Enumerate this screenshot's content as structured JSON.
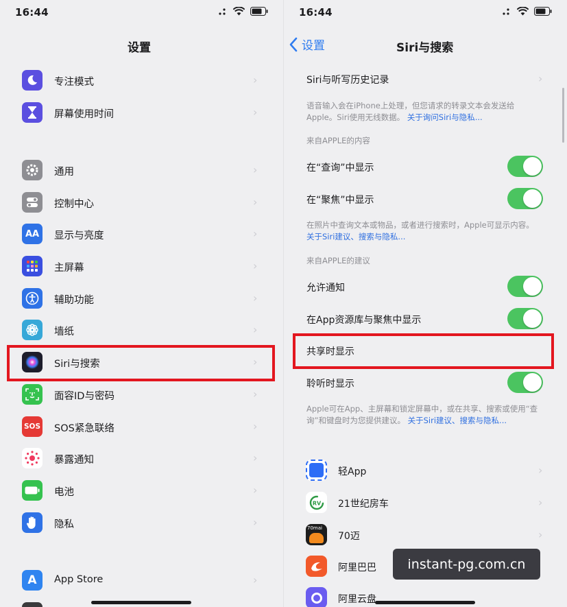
{
  "left": {
    "status": {
      "time": "16:44"
    },
    "title": "设置",
    "items": [
      {
        "label": "专注模式",
        "icon": "moon-icon",
        "color": "#5b4fe0"
      },
      {
        "label": "屏幕使用时间",
        "icon": "hourglass-icon",
        "color": "#5b4fe0"
      },
      {
        "label": "通用",
        "icon": "gear-icon",
        "color": "#8e8e93"
      },
      {
        "label": "控制中心",
        "icon": "switches-icon",
        "color": "#8e8e93"
      },
      {
        "label": "显示与亮度",
        "icon": "text-size-icon",
        "icon_text": "AA",
        "color": "#2f72e6"
      },
      {
        "label": "主屏幕",
        "icon": "grid-icon",
        "color": "#3a4fe0"
      },
      {
        "label": "辅助功能",
        "icon": "accessibility-icon",
        "color": "#2f72e6"
      },
      {
        "label": "墙纸",
        "icon": "flower-icon",
        "color": "#37a8d8"
      },
      {
        "label": "Siri与搜索",
        "icon": "siri-icon",
        "color": "#1d1d2b"
      },
      {
        "label": "面容ID与密码",
        "icon": "face-id-icon",
        "color": "#35c24f"
      },
      {
        "label": "SOS紧急联络",
        "icon": "sos-icon",
        "icon_text": "SOS",
        "color": "#e53935"
      },
      {
        "label": "暴露通知",
        "icon": "exposure-icon",
        "color": "#ffffff"
      },
      {
        "label": "电池",
        "icon": "battery-icon",
        "color": "#35c24f"
      },
      {
        "label": "隐私",
        "icon": "hand-icon",
        "color": "#2f72e6"
      },
      {
        "label": "App Store",
        "icon": "app-store-icon",
        "icon_text": "A",
        "color": "#2f84f0"
      }
    ]
  },
  "right": {
    "status": {
      "time": "16:44"
    },
    "back_label": "设置",
    "title": "Siri与搜索",
    "history_label": "Siri与听写历史记录",
    "note1": "语音输入会在iPhone上处理，但您请求的转录文本会发送给Apple。Siri使用无线数据。",
    "note1_link": "关于询问Siri与隐私...",
    "section1": "来自APPLE的内容",
    "rows1": [
      {
        "label": "在“查询”中显示",
        "on": true
      },
      {
        "label": "在“聚焦”中显示",
        "on": true
      }
    ],
    "note2": "在照片中查询文本或物品，或者进行搜索时，Apple可显示内容。",
    "note2_link": "关于Siri建议、搜索与隐私...",
    "section2": "来自APPLE的建议",
    "rows2": [
      {
        "label": "允许通知",
        "on": true
      },
      {
        "label": "在App资源库与聚焦中显示",
        "on": true
      },
      {
        "label": "共享时显示",
        "on": false
      },
      {
        "label": "聆听时显示",
        "on": true
      }
    ],
    "note3": "Apple可在App、主屏幕和锁定屏幕中，或在共享、搜索或使用“查询”和键盘时为您提供建议。",
    "note3_link": "关于Siri建议、搜索与隐私...",
    "apps": [
      {
        "label": "轻App",
        "icon": "light-app-icon",
        "color": "#2d6df6"
      },
      {
        "label": "21世纪房车",
        "icon": "rv21-icon",
        "color": "#ffffff"
      },
      {
        "label": "70迈",
        "icon": "70mai-icon",
        "icon_text": "70mai",
        "color": "#1d1d1d"
      },
      {
        "label": "阿里巴巴",
        "icon": "alibaba-icon",
        "color": "#f2592a"
      },
      {
        "label": "阿里云盘",
        "icon": "aliyun-drive-icon",
        "color": "#6a5cf0"
      }
    ]
  },
  "watermark": "instant-pg.com.cn",
  "colors": {
    "highlight": "#e3161f",
    "toggle_on": "#4bc460",
    "link": "#2f6fe0",
    "ios_blue": "#2f7cf0"
  }
}
